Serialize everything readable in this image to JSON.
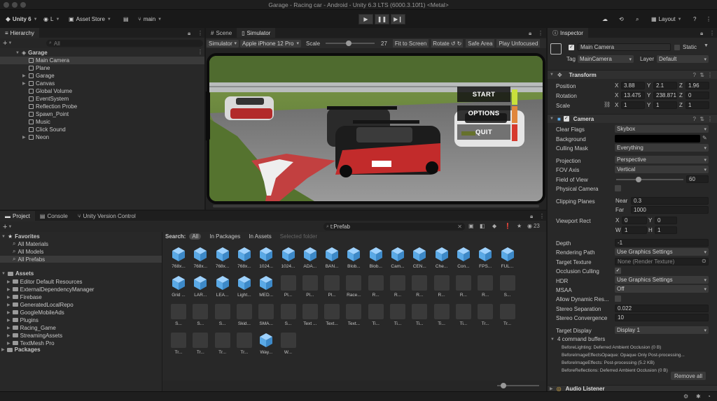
{
  "window": {
    "title": "Garage - Racing car - Android - Unity 6.3 LTS (6000.3.10f1) <Metal>"
  },
  "toolbar": {
    "unity_label": "Unity 6",
    "account_label": "L",
    "asset_store_label": "Asset Store",
    "branch_label": "main",
    "layout_label": "Layout"
  },
  "hierarchy": {
    "tab_label": "Hierarchy",
    "search_placeholder": "All",
    "scene": "Garage",
    "items": [
      {
        "label": "Main Camera",
        "expand": false,
        "selected": true
      },
      {
        "label": "Plane",
        "expand": false
      },
      {
        "label": "Garage",
        "expand": true
      },
      {
        "label": "Canvas",
        "expand": true
      },
      {
        "label": "Global Volume",
        "expand": false
      },
      {
        "label": "EventSystem",
        "expand": false
      },
      {
        "label": "Reflection Probe",
        "expand": false
      },
      {
        "label": "Spawn_Point",
        "expand": false
      },
      {
        "label": "Music",
        "expand": false
      },
      {
        "label": "Click Sound",
        "expand": false
      },
      {
        "label": "Neon",
        "expand": true
      }
    ]
  },
  "view_tabs": {
    "scene": "Scene",
    "simulator": "Simulator"
  },
  "simulator_bar": {
    "mode": "Simulator",
    "device": "Apple iPhone 12 Pro",
    "scale_label": "Scale",
    "scale_value": "27",
    "fit": "Fit to Screen",
    "rotate": "Rotate",
    "safe_area": "Safe Area",
    "play_unfocused": "Play Unfocused"
  },
  "game_menu": {
    "start": "START",
    "options": "OPTIONS",
    "quit": "QUIT"
  },
  "bottom_tabs": {
    "project": "Project",
    "console": "Console",
    "vcs": "Unity Version Control"
  },
  "project": {
    "search_value": "t:Prefab",
    "count": "23",
    "search_label": "Search:",
    "filters": [
      "All",
      "In Packages",
      "In Assets",
      "Selected folder"
    ],
    "favorites_label": "Favorites",
    "favorites": [
      "All Materials",
      "All Models",
      "All Prefabs"
    ],
    "assets_label": "Assets",
    "folders": [
      "Editor Default Resources",
      "ExternalDependencyManager",
      "Firebase",
      "GeneratedLocalRepo",
      "GoogleMobileAds",
      "Plugins",
      "Racing_Game",
      "StreamingAssets",
      "TextMesh Pro"
    ],
    "packages_label": "Packages",
    "grid_rows": [
      [
        "768x...",
        "768x...",
        "768x...",
        "768x...",
        "1024...",
        "1024...",
        "ADA...",
        "BAN...",
        "Blob...",
        "Blob...",
        "Cam...",
        "CEN...",
        "Che...",
        "Con...",
        "FPS...",
        "FUL..."
      ],
      [
        "Grid ...",
        "LAR...",
        "LEA...",
        "Light...",
        "MED...",
        "Pl...",
        "Pl...",
        "Pl...",
        "Race...",
        "R...",
        "R...",
        "R...",
        "R...",
        "R...",
        "R...",
        "S..."
      ],
      [
        "S...",
        "S...",
        "S...",
        "Skid...",
        "SMA...",
        "S...",
        "Text ...",
        "Text...",
        "Text...",
        "Ti...",
        "Ti...",
        "Ti...",
        "Ti...",
        "Ti...",
        "Tr...",
        "Tr..."
      ],
      [
        "Tr...",
        "Tr...",
        "Tr...",
        "Tr...",
        "Way...",
        "W..."
      ]
    ]
  },
  "inspector": {
    "tab_label": "Inspector",
    "object_name": "Main Camera",
    "static_label": "Static",
    "tag_label": "Tag",
    "tag_value": "MainCamera",
    "layer_label": "Layer",
    "layer_value": "Default",
    "transform": {
      "title": "Transform",
      "position": {
        "label": "Position",
        "x": "3.88",
        "y": "2.1",
        "z": "1.96"
      },
      "rotation": {
        "label": "Rotation",
        "x": "13.475",
        "y": "238.871",
        "z": "0"
      },
      "scale": {
        "label": "Scale",
        "x": "1",
        "y": "1",
        "z": "1"
      }
    },
    "camera": {
      "title": "Camera",
      "clear_flags": {
        "label": "Clear Flags",
        "value": "Skybox"
      },
      "background": {
        "label": "Background"
      },
      "culling_mask": {
        "label": "Culling Mask",
        "value": "Everything"
      },
      "projection": {
        "label": "Projection",
        "value": "Perspective"
      },
      "fov_axis": {
        "label": "FOV Axis",
        "value": "Vertical"
      },
      "fov": {
        "label": "Field of View",
        "value": "60"
      },
      "physical": {
        "label": "Physical Camera"
      },
      "clipping": {
        "label": "Clipping Planes",
        "near_label": "Near",
        "near": "0.3",
        "far_label": "Far",
        "far": "1000"
      },
      "viewport": {
        "label": "Viewport Rect",
        "x_label": "X",
        "x": "0",
        "y_label": "Y",
        "y": "0",
        "w_label": "W",
        "w": "1",
        "h_label": "H",
        "h": "1"
      },
      "depth": {
        "label": "Depth",
        "value": "-1"
      },
      "rendering_path": {
        "label": "Rendering Path",
        "value": "Use Graphics Settings"
      },
      "target_texture": {
        "label": "Target Texture",
        "value": "None (Render Texture)"
      },
      "occlusion": {
        "label": "Occlusion Culling"
      },
      "hdr": {
        "label": "HDR",
        "value": "Use Graphics Settings"
      },
      "msaa": {
        "label": "MSAA",
        "value": "Off"
      },
      "dynamic_res": {
        "label": "Allow Dynamic Res..."
      },
      "stereo_sep": {
        "label": "Stereo Separation",
        "value": "0.022"
      },
      "stereo_conv": {
        "label": "Stereo Convergence",
        "value": "10"
      },
      "target_display": {
        "label": "Target Display",
        "value": "Display 1"
      },
      "command_buffers": {
        "title": "4 command buffers",
        "items": [
          "BeforeLighting: Deferred Ambient Occlusion (0 B)",
          "BeforeImageEffectsOpaque: Opaque Only Post-processing...",
          "BeforeImageEffects: Post-processing (5.2 KB)",
          "BeforeReflections: Deferred Ambient Occlusion (0 B)"
        ],
        "remove_all": "Remove all"
      }
    },
    "audio_listener": "Audio Listener"
  },
  "colors": {
    "accent": "#2c5d87",
    "bg": "#282828",
    "cube_blue": "#5aa9e6"
  }
}
